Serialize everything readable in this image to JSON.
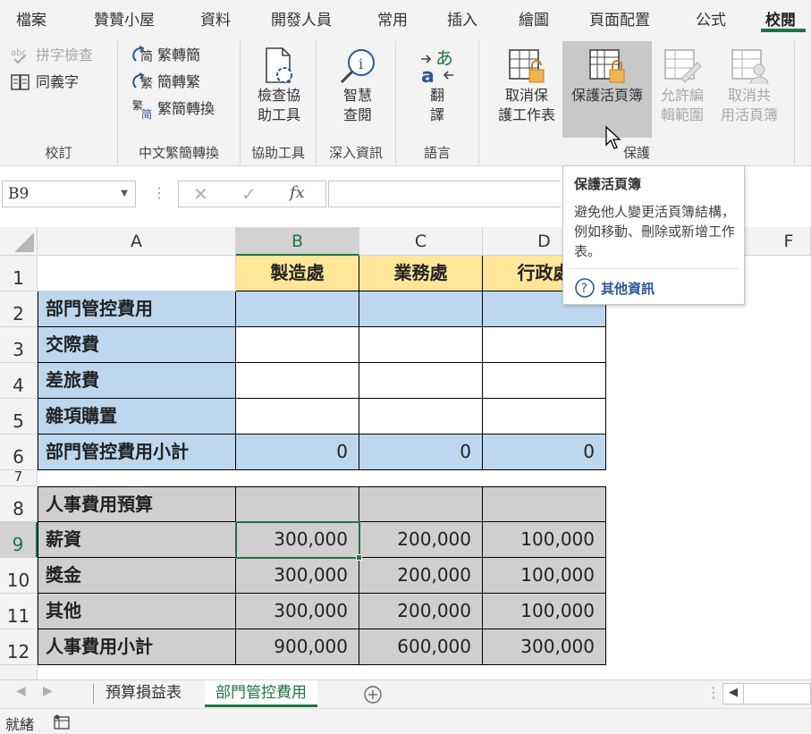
{
  "menu": {
    "tabs": [
      "檔案",
      "贊贊小屋",
      "資料",
      "開發人員",
      "常用",
      "插入",
      "繪圖",
      "頁面配置",
      "公式",
      "校閱"
    ],
    "active_tab": "校閱"
  },
  "ribbon": {
    "proofing": {
      "spell_check": "拼字檢查",
      "thesaurus": "同義字",
      "label": "校訂"
    },
    "chinese_conversion": {
      "to_simplified": "繁轉簡",
      "to_traditional": "簡轉繁",
      "conversion": "繁簡轉換",
      "label": "中文繁簡轉換"
    },
    "accessibility": {
      "check_line1": "檢查協",
      "check_line2": "助工具",
      "label": "協助工具"
    },
    "insights": {
      "smart_line1": "智慧",
      "smart_line2": "查閱",
      "label": "深入資訊"
    },
    "language": {
      "translate_line1": "翻",
      "translate_line2": "譯",
      "label": "語言"
    },
    "protect": {
      "unprotect_line1": "取消保",
      "unprotect_line2": "護工作表",
      "protect_workbook": "保護活頁簿",
      "allow_line1": "允許編",
      "allow_line2": "輯範圍",
      "unshare_line1": "取消共",
      "unshare_line2": "用活頁簿",
      "label": "保護"
    }
  },
  "formula_bar": {
    "name_box": "B9",
    "fx": "fx",
    "value": ""
  },
  "tooltip": {
    "title": "保護活頁簿",
    "description": "避免他人變更活頁簿結構，例如移動、刪除或新增工作表。",
    "link": "其他資訊"
  },
  "columns": [
    "A",
    "B",
    "C",
    "D",
    "F"
  ],
  "rows": [
    "1",
    "2",
    "3",
    "4",
    "5",
    "6",
    "7",
    "8",
    "9",
    "10",
    "11",
    "12"
  ],
  "sheet": {
    "header": [
      "",
      "製造處",
      "業務處",
      "行政處"
    ],
    "r2": [
      "部門管控費用",
      "",
      "",
      ""
    ],
    "r3": [
      "交際費",
      "",
      "",
      ""
    ],
    "r4": [
      "差旅費",
      "",
      "",
      ""
    ],
    "r5": [
      "雜項購置",
      "",
      "",
      ""
    ],
    "r6": [
      "部門管控費用小計",
      "0",
      "0",
      "0"
    ],
    "r8": [
      "人事費用預算",
      "",
      "",
      ""
    ],
    "r9": [
      "薪資",
      "300,000",
      "200,000",
      "100,000"
    ],
    "r10": [
      "獎金",
      "300,000",
      "200,000",
      "100,000"
    ],
    "r11": [
      "其他",
      "300,000",
      "200,000",
      "100,000"
    ],
    "r12": [
      "人事費用小計",
      "900,000",
      "600,000",
      "300,000"
    ]
  },
  "sheet_tabs": [
    "預算損益表",
    "部門管控費用"
  ],
  "active_sheet": "部門管控費用",
  "status": "就緒",
  "colors": {
    "accent": "#217346",
    "header_fill": "#ffe699",
    "blue_fill": "#bdd7ee",
    "gray_fill": "#d0cece"
  }
}
